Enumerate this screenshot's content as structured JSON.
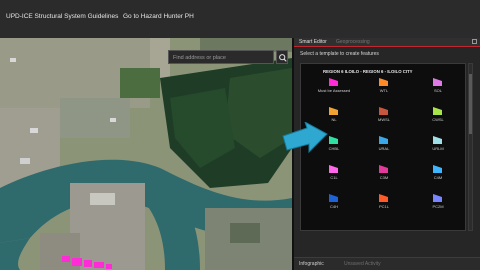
{
  "header": {
    "links": [
      "UPD-ICE Structural System Guidelines",
      "Go to Hazard Hunter PH"
    ]
  },
  "map": {
    "search_placeholder": "Find address or place",
    "search_icon": "search-icon"
  },
  "panel": {
    "tabs": [
      "Smart Editor",
      "Geoprocessing"
    ],
    "active_tab": "Smart Editor",
    "hint": "Select a template to create features",
    "layer_title": "REGION 6 ILOILO - REGION 6 - ILOILO CITY",
    "templates": [
      {
        "label": "Must be Assessed",
        "color": "#ff2bd6"
      },
      {
        "label": "WTL",
        "color": "#ff8a2a"
      },
      {
        "label": "SOL",
        "color": "#e079e8"
      },
      {
        "label": "NL",
        "color": "#f2a233"
      },
      {
        "label": "MWSL",
        "color": "#c8553d"
      },
      {
        "label": "CWSL",
        "color": "#a8e34a"
      },
      {
        "label": "CHBL",
        "color": "#2fe0a0"
      },
      {
        "label": "URAL",
        "color": "#3aa7e8"
      },
      {
        "label": "URLM",
        "color": "#9fe0e8"
      },
      {
        "label": "C1L",
        "color": "#ff66e8"
      },
      {
        "label": "C3M",
        "color": "#e23a9a"
      },
      {
        "label": "C4M",
        "color": "#3eb6ff"
      },
      {
        "label": "C4H",
        "color": "#1f62d6"
      },
      {
        "label": "PC1L",
        "color": "#ff5a28"
      },
      {
        "label": "PC2M",
        "color": "#7a86ff"
      }
    ],
    "bottom_tabs": [
      "Infographic",
      "Unsaved Activity"
    ]
  },
  "colors": {
    "accent": "#c0282f",
    "arrow": "#2ea8d0"
  }
}
